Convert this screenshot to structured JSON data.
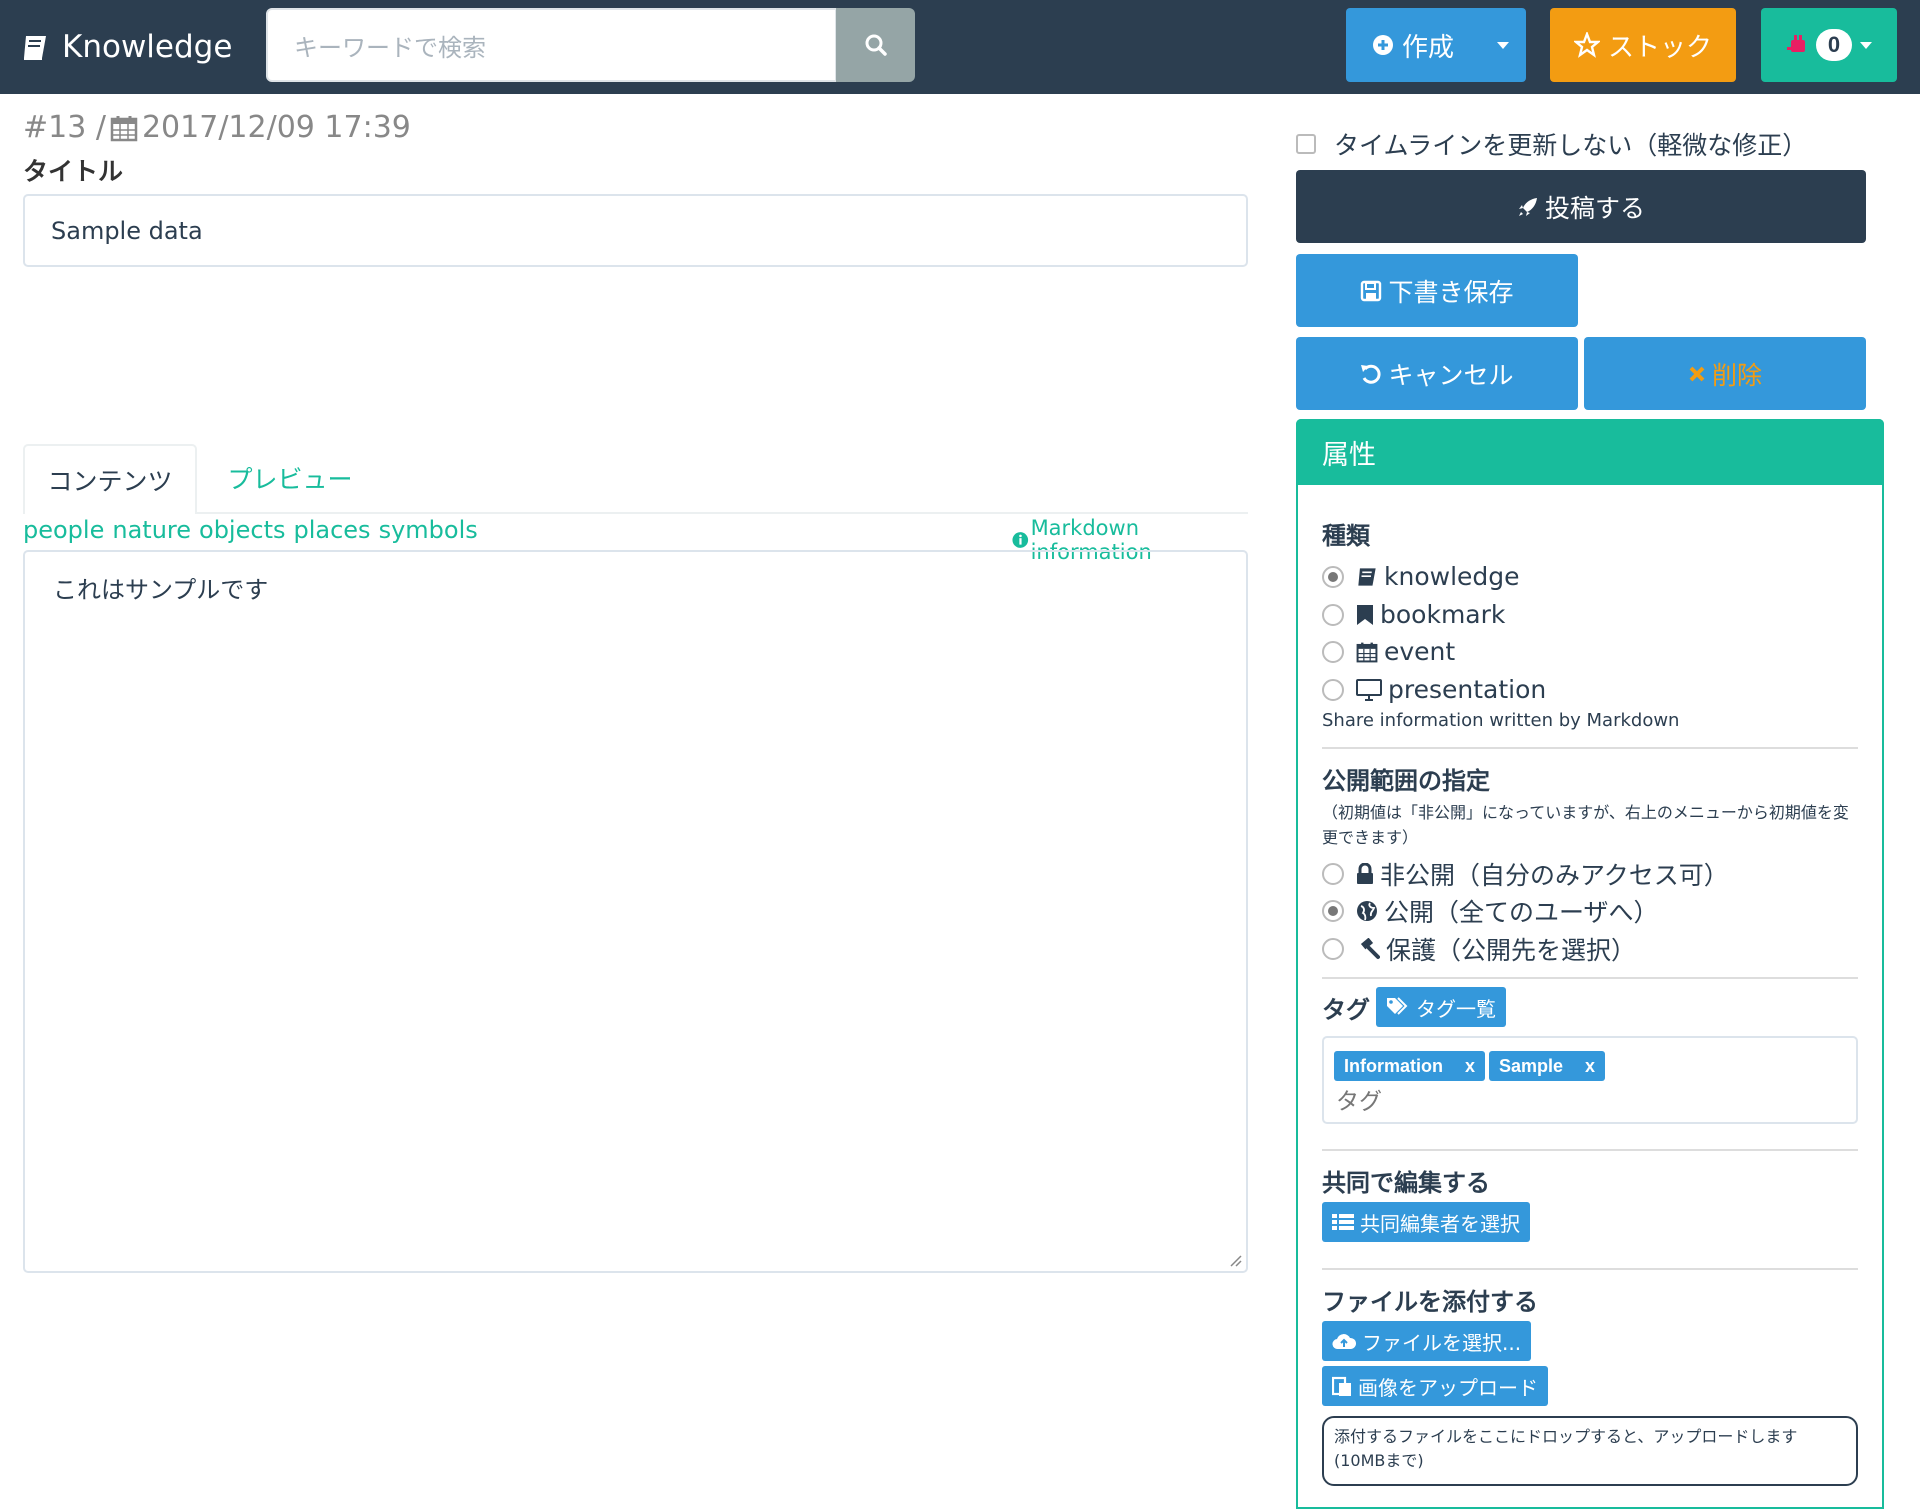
{
  "navbar": {
    "brand": "Knowledge",
    "search_placeholder": "キーワードで検索",
    "create_label": "作成",
    "stock_label": "ストック",
    "notification_count": "0"
  },
  "meta": {
    "id": "#13 /",
    "datetime": "2017/12/09 17:39"
  },
  "form": {
    "title_label": "タイトル",
    "title_value": "Sample data",
    "tabs": [
      "コンテンツ",
      "プレビュー"
    ],
    "emoji_links": [
      "people",
      "nature",
      "objects",
      "places",
      "symbols"
    ],
    "markdown_info": "Markdown information",
    "content_value": "これはサンプルです"
  },
  "actions": {
    "timeline_checkbox": "タイムラインを更新しない（軽微な修正）",
    "post": "投稿する",
    "draft": "下書き保存",
    "cancel": "キャンセル",
    "delete": "削除"
  },
  "panel": {
    "title": "属性",
    "type_title": "種類",
    "types": [
      {
        "label": "knowledge",
        "icon": "book-icon",
        "selected": true
      },
      {
        "label": "bookmark",
        "icon": "bookmark-icon",
        "selected": false
      },
      {
        "label": "event",
        "icon": "calendar-icon",
        "selected": false
      },
      {
        "label": "presentation",
        "icon": "monitor-icon",
        "selected": false
      }
    ],
    "type_help": "Share information written by Markdown",
    "scope_title": "公開範囲の指定",
    "scope_help": "（初期値は「非公開」になっていますが、右上のメニューから初期値を変更できます）",
    "scopes": [
      {
        "label": "非公開（自分のみアクセス可）",
        "icon": "lock-icon",
        "selected": false
      },
      {
        "label": "公開（全てのユーザへ）",
        "icon": "globe-icon",
        "selected": true
      },
      {
        "label": "保護（公開先を選択）",
        "icon": "gavel-icon",
        "selected": false
      }
    ],
    "tag_title": "タグ",
    "tag_list_button": "タグ一覧",
    "tags": [
      "Information",
      "Sample"
    ],
    "tag_remove": "x",
    "tag_placeholder": "タグ",
    "coedit_title": "共同で編集する",
    "coedit_button": "共同編集者を選択",
    "attach_title": "ファイルを添付する",
    "file_button": "ファイルを選択...",
    "image_button": "画像をアップロード",
    "drop_text": "添付するファイルをここにドロップすると、アップロードします(10MBまで)"
  },
  "colors": {
    "navbar": "#2c3e50",
    "primary": "#3498db",
    "success": "#18bc9c",
    "warning": "#f39c12",
    "muted": "#95a5a6"
  }
}
